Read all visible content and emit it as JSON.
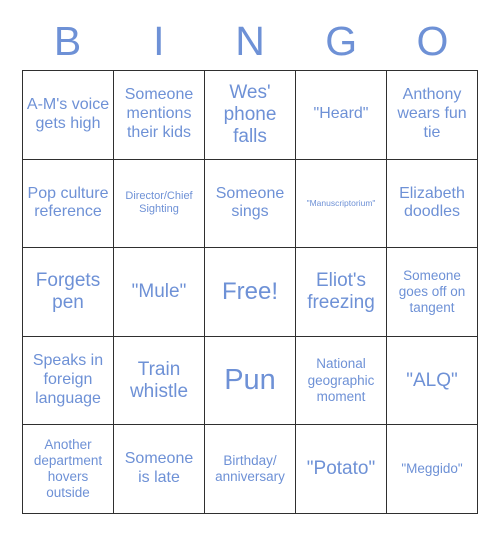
{
  "card": {
    "header_letters": [
      "B",
      "I",
      "N",
      "G",
      "O"
    ],
    "text_color": "#6e91d6",
    "border_color": "#2f2f2f",
    "background_color": "#ffffff"
  },
  "grid": {
    "rows": 5,
    "columns": 5,
    "cells": [
      {
        "text": "A-M's voice gets high",
        "size": "m"
      },
      {
        "text": "Someone mentions their kids",
        "size": "m"
      },
      {
        "text": "Wes' phone falls",
        "size": "l"
      },
      {
        "text": "\"Heard\"",
        "size": "m"
      },
      {
        "text": "Anthony wears fun tie",
        "size": "m"
      },
      {
        "text": "Pop culture reference",
        "size": "m"
      },
      {
        "text": "Director/Chief Sighting",
        "size": "xs"
      },
      {
        "text": "Someone sings",
        "size": "m"
      },
      {
        "text": "\"Manuscriptorium\"",
        "size": "xxs"
      },
      {
        "text": "Elizabeth doodles",
        "size": "m"
      },
      {
        "text": "Forgets pen",
        "size": "l"
      },
      {
        "text": "\"Mule\"",
        "size": "l"
      },
      {
        "text": "Free!",
        "size": "xl"
      },
      {
        "text": "Eliot's freezing",
        "size": "l"
      },
      {
        "text": "Someone goes off on tangent",
        "size": "s"
      },
      {
        "text": "Speaks in foreign language",
        "size": "m"
      },
      {
        "text": "Train whistle",
        "size": "l"
      },
      {
        "text": "Pun",
        "size": "xxl"
      },
      {
        "text": "National geographic moment",
        "size": "s"
      },
      {
        "text": "\"ALQ\"",
        "size": "l"
      },
      {
        "text": "Another department hovers outside",
        "size": "s"
      },
      {
        "text": "Someone is late",
        "size": "m"
      },
      {
        "text": "Birthday/ anniversary",
        "size": "s"
      },
      {
        "text": "\"Potato\"",
        "size": "l"
      },
      {
        "text": "\"Meggido\"",
        "size": "s"
      }
    ]
  }
}
